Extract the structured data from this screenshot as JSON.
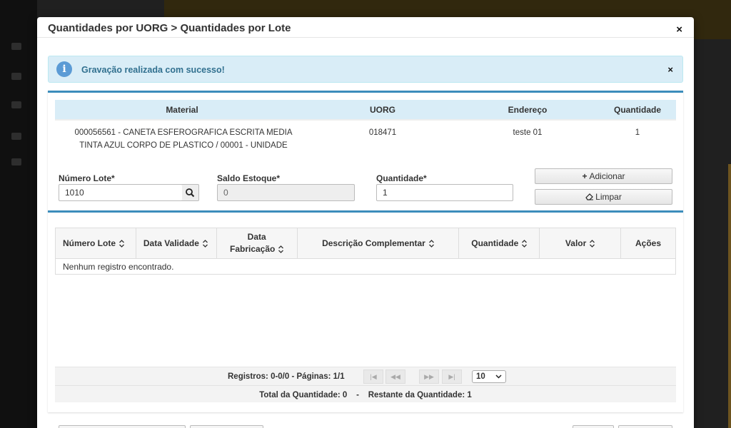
{
  "modal": {
    "title": "Quantidades por UORG > Quantidades por Lote",
    "close_glyph": "×"
  },
  "alert": {
    "icon": "info-icon",
    "icon_glyph": "i",
    "message": "Gravação realizada com sucesso!",
    "close_glyph": "×",
    "color": "#31708f"
  },
  "material": {
    "headers": [
      "Material",
      "UORG",
      "Endereço",
      "Quantidade"
    ],
    "row": {
      "material": "000056561 - CANETA ESFEROGRAFICA ESCRITA MEDIA TINTA AZUL CORPO DE PLASTICO / 00001 - UNIDADE",
      "uorg": "018471",
      "endereco": "teste 01",
      "quantidade": "1"
    }
  },
  "form": {
    "numero_lote": {
      "label": "Número Lote*",
      "value": "1010"
    },
    "saldo_estoque": {
      "label": "Saldo Estoque*",
      "value": "0"
    },
    "quantidade": {
      "label": "Quantidade*",
      "value": "1"
    },
    "add_label": "Adicionar",
    "add_glyph": "+",
    "clear_label": "Limpar",
    "clear_icon": "eraser-icon"
  },
  "lotes_table": {
    "headers": {
      "numero_lote": "Número Lote",
      "data_validade": "Data Validade",
      "data_fabricacao_1": "Data",
      "data_fabricacao_2": "Fabricação",
      "descricao": "Descrição Complementar",
      "quantidade": "Quantidade",
      "valor": "Valor",
      "acoes": "Ações"
    },
    "empty_message": "Nenhum registro encontrado."
  },
  "paginator": {
    "info": "Registros: 0-0/0 - Páginas: 1/1",
    "first_glyph": "|◀",
    "prev_glyph": "◀◀",
    "next_glyph": "▶▶",
    "last_glyph": "▶|",
    "page_size": "10",
    "totals": "Total da Quantidade: 0    -    Restante da Quantidade: 1"
  },
  "colors": {
    "accent": "#3c8dbc",
    "alert_bg": "#d9edf7"
  }
}
